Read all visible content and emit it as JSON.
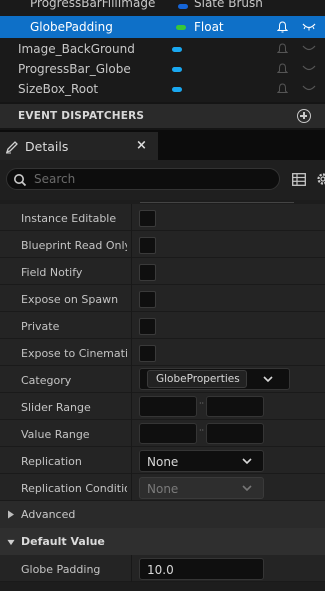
{
  "variables": {
    "rows": [
      {
        "name": "ProgressBarFillImage",
        "type": "Slate Brush",
        "color": "#1565d8",
        "selected": false
      },
      {
        "name": "GlobePadding",
        "type": "Float",
        "color": "#38c838",
        "selected": true
      },
      {
        "name": "Image_BackGround",
        "type": "",
        "color": "#1aa8f0",
        "selected": false
      },
      {
        "name": "ProgressBar_Globe",
        "type": "",
        "color": "#1aa8f0",
        "selected": false
      },
      {
        "name": "SizeBox_Root",
        "type": "",
        "color": "#1aa8f0",
        "selected": false
      }
    ],
    "event_dispatchers_label": "EVENT DISPATCHERS"
  },
  "details": {
    "tab_title": "Details",
    "close_glyph": "×",
    "search_placeholder": "Search",
    "properties": {
      "instance_editable": "Instance Editable",
      "blueprint_read_only": "Blueprint Read Only",
      "field_notify": "Field Notify",
      "expose_on_spawn": "Expose on Spawn",
      "private": "Private",
      "expose_to_cinematics": "Expose to Cinematics",
      "category": "Category",
      "category_value": "GlobeProperties",
      "slider_range": "Slider Range",
      "value_range": "Value Range",
      "replication": "Replication",
      "replication_value": "None",
      "replication_condition": "Replication Condition",
      "replication_condition_value": "None"
    },
    "sections": {
      "advanced": "Advanced",
      "default_value": "Default Value"
    },
    "default_value": {
      "label": "Globe Padding",
      "value": "10.0"
    }
  },
  "colors": {
    "selection": "#0e70c8",
    "float_pin": "#38c838",
    "object_pin": "#1aa8f0",
    "struct_pin": "#1565d8"
  }
}
